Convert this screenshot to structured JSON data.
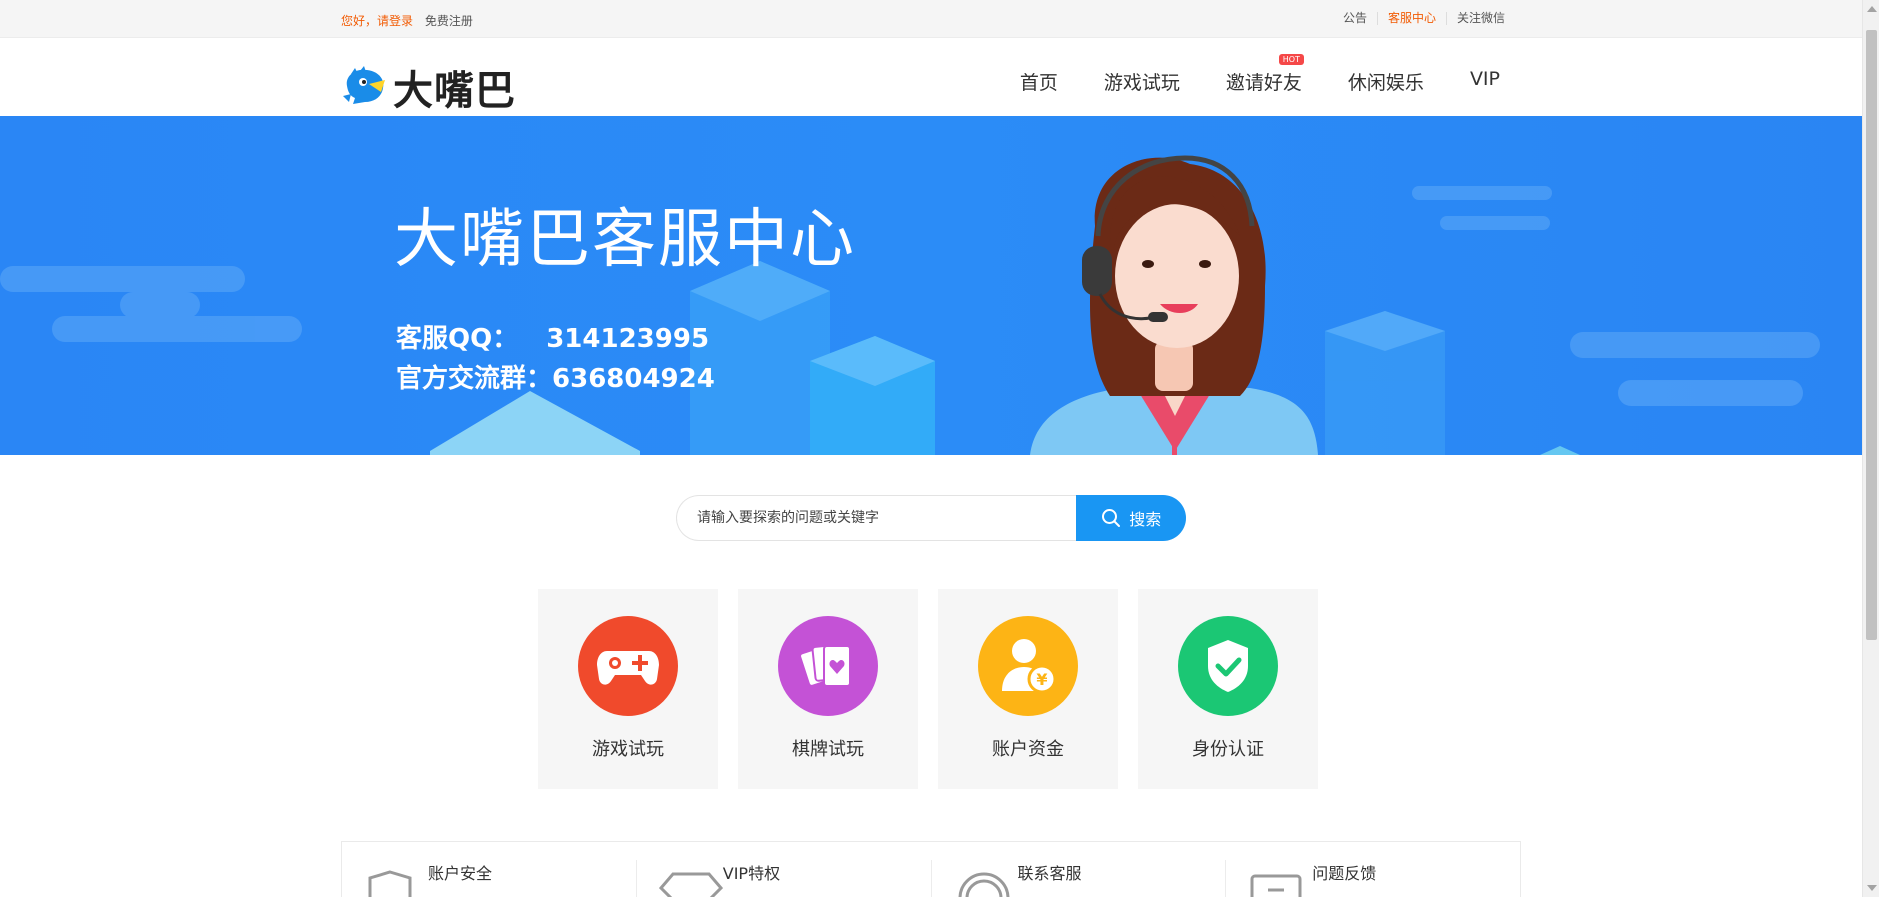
{
  "topbar": {
    "login_text": "您好，请登录",
    "register_text": "免费注册",
    "links": [
      "公告",
      "客服中心",
      "关注微信"
    ],
    "active_link_index": 1
  },
  "header": {
    "brand": "大嘴巴",
    "nav": [
      {
        "label": "首页"
      },
      {
        "label": "游戏试玩"
      },
      {
        "label": "邀请好友",
        "badge": "HOT"
      },
      {
        "label": "休闲娱乐"
      },
      {
        "label": "VIP"
      }
    ]
  },
  "banner": {
    "title": "大嘴巴客服中心",
    "qq_label": "客服QQ：",
    "qq_value": "314123995",
    "group_label": "官方交流群：",
    "group_value": "636804924"
  },
  "search": {
    "placeholder": "请输入要探索的问题或关键字",
    "button_label": "搜索"
  },
  "categories": [
    {
      "label": "游戏试玩",
      "icon": "gamepad-icon",
      "color": "#f04a2c"
    },
    {
      "label": "棋牌试玩",
      "icon": "cards-icon",
      "color": "#c452d6"
    },
    {
      "label": "账户资金",
      "icon": "user-money-icon",
      "color": "#fdb415"
    },
    {
      "label": "身份认证",
      "icon": "shield-check-icon",
      "color": "#1bc774"
    }
  ],
  "help": [
    {
      "label": "账户安全",
      "icon": "shield-outline-icon"
    },
    {
      "label": "VIP特权",
      "icon": "diamond-icon"
    },
    {
      "label": "联系客服",
      "icon": "headset-icon"
    },
    {
      "label": "问题反馈",
      "icon": "feedback-icon"
    }
  ],
  "colors": {
    "accent": "#f25c05",
    "banner_blue": "#2a86f5",
    "search_blue": "#1996f3"
  }
}
